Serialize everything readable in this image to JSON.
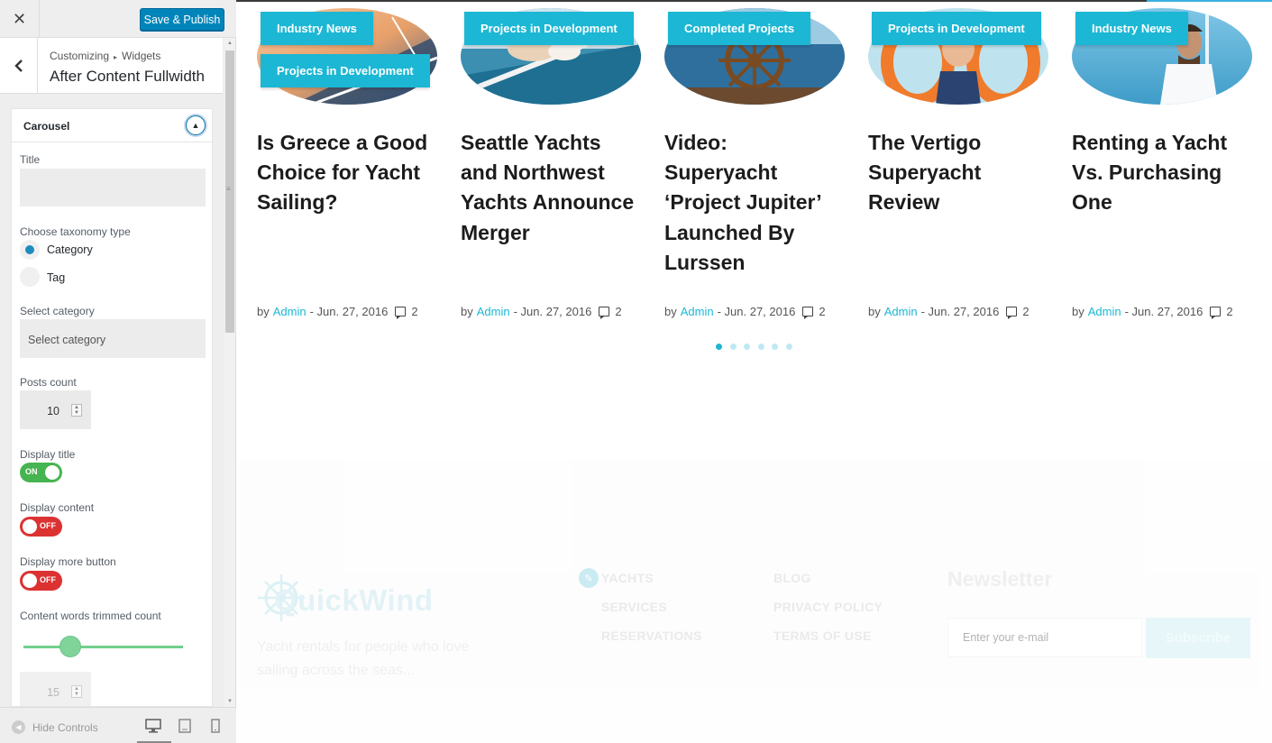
{
  "header": {
    "close_icon": "close-icon",
    "save_label": "Save & Publish"
  },
  "section": {
    "breadcrumb_root": "Customizing",
    "breadcrumb_child": "Widgets",
    "title": "After Content Fullwidth"
  },
  "widget": {
    "name": "Carousel",
    "fields": {
      "title_label": "Title",
      "title_value": "",
      "taxonomy_label": "Choose taxonomy type",
      "taxonomy_options": [
        "Category",
        "Tag"
      ],
      "taxonomy_selected": "Category",
      "category_label": "Select category",
      "category_placeholder": "Select category",
      "posts_count_label": "Posts count",
      "posts_count_value": "10",
      "display_title_label": "Display title",
      "display_title_state": "ON",
      "display_content_label": "Display content",
      "display_content_state": "OFF",
      "display_more_label": "Display more button",
      "display_more_state": "OFF",
      "trim_label": "Content words trimmed count",
      "trim_slider_fraction": 0.3,
      "trim_value": "15"
    }
  },
  "footer_bar": {
    "hide_label": "Hide Controls",
    "devices": [
      "desktop-icon",
      "tablet-icon",
      "mobile-icon"
    ]
  },
  "colors": {
    "accent": "#1cb7d4",
    "wp_blue": "#0085ba",
    "toggle_on": "#46b450",
    "toggle_off": "#dc3232"
  },
  "posts": [
    {
      "tags": [
        "Industry News",
        "Projects in Development"
      ],
      "title": "Is Greece a Good Choice for Yacht Sailing?",
      "by": "by",
      "author": "Admin",
      "date": "- Jun. 27, 2016",
      "comments": "2"
    },
    {
      "tags": [
        "Projects in Development"
      ],
      "title": "Seattle Yachts and Northwest Yachts Announce Merger",
      "by": "by",
      "author": "Admin",
      "date": "- Jun. 27, 2016",
      "comments": "2"
    },
    {
      "tags": [
        "Completed Projects"
      ],
      "title": "Video: Superyacht ‘Project Jupiter’ Launched By Lurssen",
      "by": "by",
      "author": "Admin",
      "date": "- Jun. 27, 2016",
      "comments": "2"
    },
    {
      "tags": [
        "Projects in Development"
      ],
      "title": "The Vertigo Superyacht Review",
      "by": "by",
      "author": "Admin",
      "date": "- Jun. 27, 2016",
      "comments": "2"
    },
    {
      "tags": [
        "Industry News"
      ],
      "title": "Renting a Yacht Vs. Purchasing One",
      "by": "by",
      "author": "Admin",
      "date": "- Jun. 27, 2016",
      "comments": "2"
    }
  ],
  "carousel": {
    "pages": 6,
    "active": 1
  },
  "site_footer": {
    "logo": "QuickWind",
    "description": "Yacht rentals for people who love sailing across the seas...",
    "nav_col1": [
      "YACHTS",
      "SERVICES",
      "RESERVATIONS"
    ],
    "nav_col2": [
      "BLOG",
      "PRIVACY POLICY",
      "TERMS OF USE"
    ],
    "newsletter_title": "Newsletter",
    "newsletter_placeholder": "Enter your e-mail",
    "subscribe_label": "Subscribe"
  }
}
